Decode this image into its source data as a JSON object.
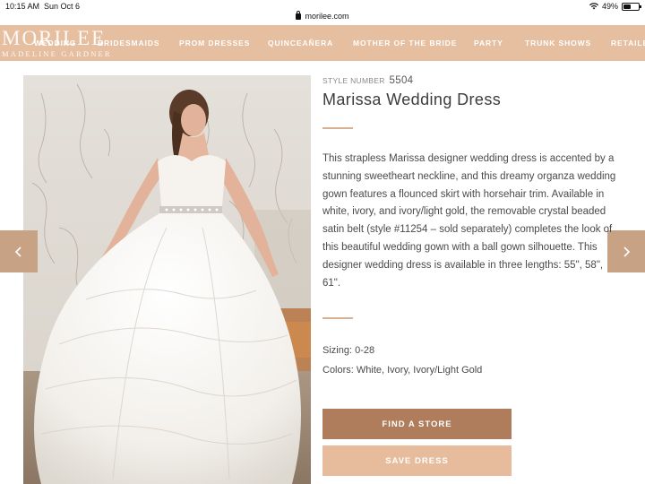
{
  "status_bar": {
    "time": "10:15 AM",
    "date": "Sun Oct 6",
    "url": "morilee.com",
    "battery": "49%",
    "battery_level": 0.49
  },
  "header": {
    "logo_main": "MORILEE",
    "logo_sub": "MADELINE GARDNER",
    "nav": [
      "WEDDING",
      "BRIDESMAIDS",
      "PROM DRESSES",
      "QUINCEAÑERA",
      "MOTHER OF THE BRIDE",
      "PARTY",
      "TRUNK SHOWS",
      "RETAILE"
    ],
    "accent_color": "#e6bea0"
  },
  "product": {
    "style_label": "STYLE NUMBER",
    "style_number": "5504",
    "name": "Marissa Wedding Dress",
    "description": "This strapless Marissa designer wedding dress is accented by a stunning sweetheart neckline, and this dreamy organza wedding gown features a flounced skirt with horsehair trim. Available in white, ivory, and ivory/light gold, the removable crystal beaded satin belt (style #11254 – sold separately) completes the look of this beautiful wedding gown with a ball gown silhouette. This designer wedding dress is available in three lengths: 55\", 58\", 61\".",
    "sizing": "Sizing: 0-28",
    "colors": "Colors: White, Ivory, Ivory/Light Gold"
  },
  "buttons": {
    "find_store": "FIND A STORE",
    "save_dress": "SAVE DRESS"
  },
  "icons": {
    "prev": "chevron-left-icon",
    "next": "chevron-right-icon"
  }
}
